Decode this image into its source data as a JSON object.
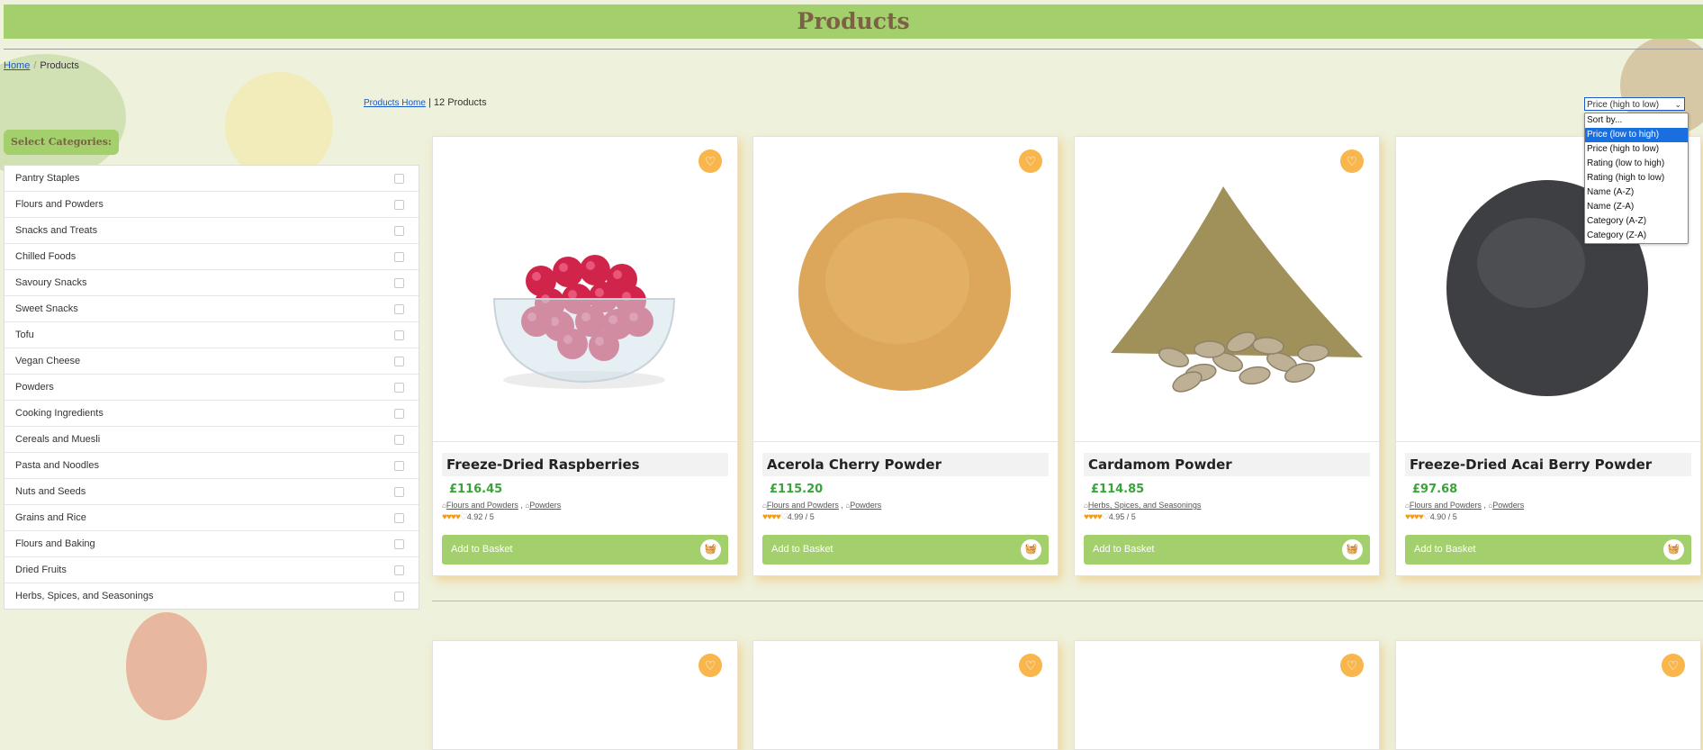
{
  "header": {
    "title": "Products"
  },
  "breadcrumb": {
    "home": "Home",
    "separator": "/",
    "current": "Products"
  },
  "listing": {
    "home_link": "Products Home",
    "separator": "|",
    "count": "12 Products"
  },
  "categories": {
    "title": "Select Categories:",
    "items": [
      "Pantry Staples",
      "Flours and Powders",
      "Snacks and Treats",
      "Chilled Foods",
      "Savoury Snacks",
      "Sweet Snacks",
      "Tofu",
      "Vegan Cheese",
      "Powders",
      "Cooking Ingredients",
      "Cereals and Muesli",
      "Pasta and Noodles",
      "Nuts and Seeds",
      "Grains and Rice",
      "Flours and Baking",
      "Dried Fruits",
      "Herbs, Spices, and Seasonings"
    ]
  },
  "sort": {
    "selected": "Price (high to low)",
    "chevron": "⌄",
    "highlighted_option": "Price (low to high)",
    "options": [
      "Sort by...",
      "Price (low to high)",
      "Price (high to low)",
      "Rating (low to high)",
      "Rating (high to low)",
      "Name (A-Z)",
      "Name (Z-A)",
      "Category (A-Z)",
      "Category (Z-A)"
    ]
  },
  "products": [
    {
      "name": "Freeze-Dried Raspberries",
      "price": "£116.45",
      "tags": [
        "Flours and Powders",
        "Powders"
      ],
      "rating": "4.92 / 5",
      "rating_value": 4.92,
      "image": "raspberries-bowl"
    },
    {
      "name": "Acerola Cherry Powder",
      "price": "£115.20",
      "tags": [
        "Flours and Powders",
        "Powders"
      ],
      "rating": "4.99 / 5",
      "rating_value": 4.99,
      "image": "acerola-powder"
    },
    {
      "name": "Cardamom Powder",
      "price": "£114.85",
      "tags": [
        "Herbs, Spices, and Seasonings"
      ],
      "rating": "4.95 / 5",
      "rating_value": 4.95,
      "image": "cardamom-powder"
    },
    {
      "name": "Freeze-Dried Acai Berry Powder",
      "price": "£97.68",
      "tags": [
        "Flours and Powders",
        "Powders"
      ],
      "rating": "4.90 / 5",
      "rating_value": 4.9,
      "image": "acai-powder"
    }
  ],
  "buttons": {
    "add_to_basket": "Add to Basket"
  },
  "icons": {
    "favourite": "heart-icon",
    "basket": "basket-icon",
    "tag": "tag-icon",
    "star": "star-icon"
  },
  "colors": {
    "accent_green": "#a4cf6d",
    "price_green": "#3aa33a",
    "favourite_orange": "#f8b64c",
    "title_brown": "#7c6146",
    "star_orange": "#f59a12"
  }
}
